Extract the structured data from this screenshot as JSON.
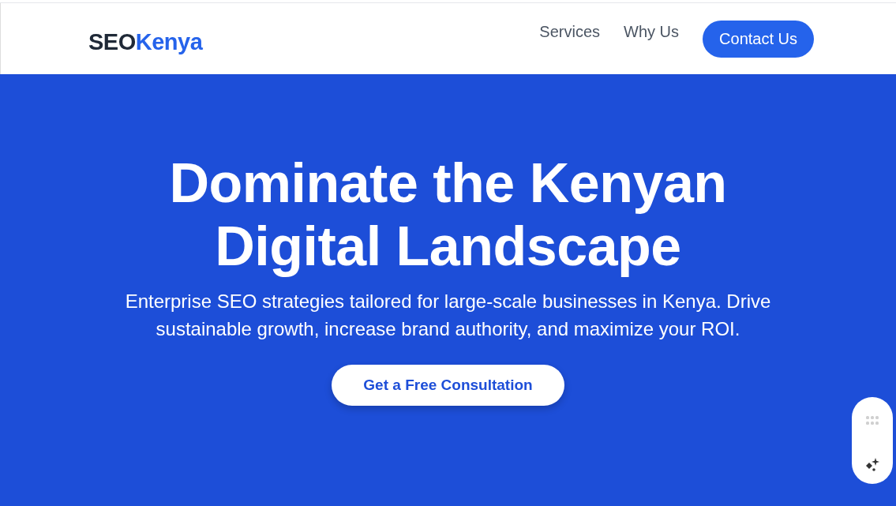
{
  "header": {
    "logo": {
      "first": "SEO",
      "second": "Kenya"
    },
    "nav": [
      "Services",
      "Why Us"
    ],
    "cta": "Contact Us"
  },
  "hero": {
    "title_lines": [
      "Dominate the Kenyan",
      "Digital Landscape"
    ],
    "subtitle": "Enterprise SEO strategies tailored for large-scale businesses in Kenya. Drive sustainable growth, increase brand authority, and maximize your ROI.",
    "button": "Get a Free Consultation"
  }
}
